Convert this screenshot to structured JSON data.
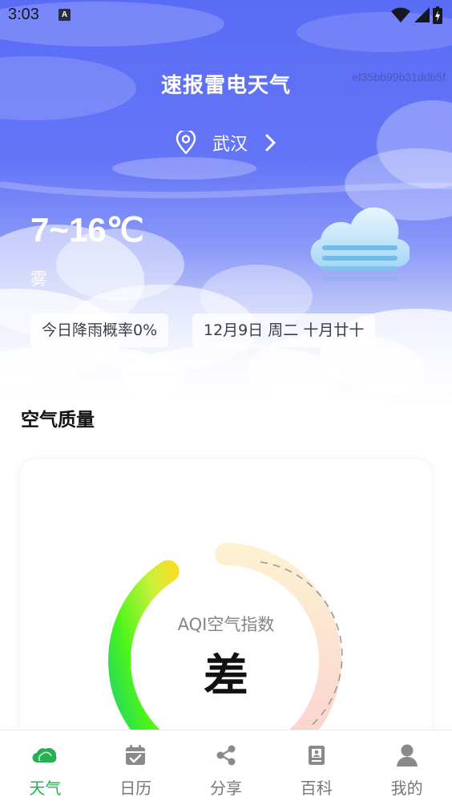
{
  "status_bar": {
    "time": "3:03",
    "notification_letter": "A",
    "icons": [
      "wifi-icon",
      "cellular-signal-icon",
      "battery-charging-icon"
    ]
  },
  "header": {
    "title": "速报雷电天气",
    "device_id": "ef35bb99b31ddb5f"
  },
  "location": {
    "city": "武汉",
    "icon": "location-pin-icon",
    "chevron": "chevron-right-icon"
  },
  "weather": {
    "temperature_range": "7~16℃",
    "condition": "雾",
    "condition_icon": "fog-cloud-icon",
    "rain_probability": "今日降雨概率0%",
    "date_info": "12月9日 周二 十月廿十"
  },
  "air_quality": {
    "section_title": "空气质量",
    "index_label": "AQI空气指数",
    "index_value": "差",
    "gauge_level": 0.39
  },
  "bottom_nav": {
    "items": [
      {
        "label": "天气",
        "icon": "cloud-icon",
        "active": true
      },
      {
        "label": "日历",
        "icon": "calendar-check-icon",
        "active": false
      },
      {
        "label": "分享",
        "icon": "share-icon",
        "active": false
      },
      {
        "label": "百科",
        "icon": "book-icon",
        "active": false
      },
      {
        "label": "我的",
        "icon": "user-icon",
        "active": false
      }
    ]
  },
  "colors": {
    "sky_blue": "#5a6cf6",
    "active_green": "#27b052",
    "inactive_gray": "#777777"
  }
}
